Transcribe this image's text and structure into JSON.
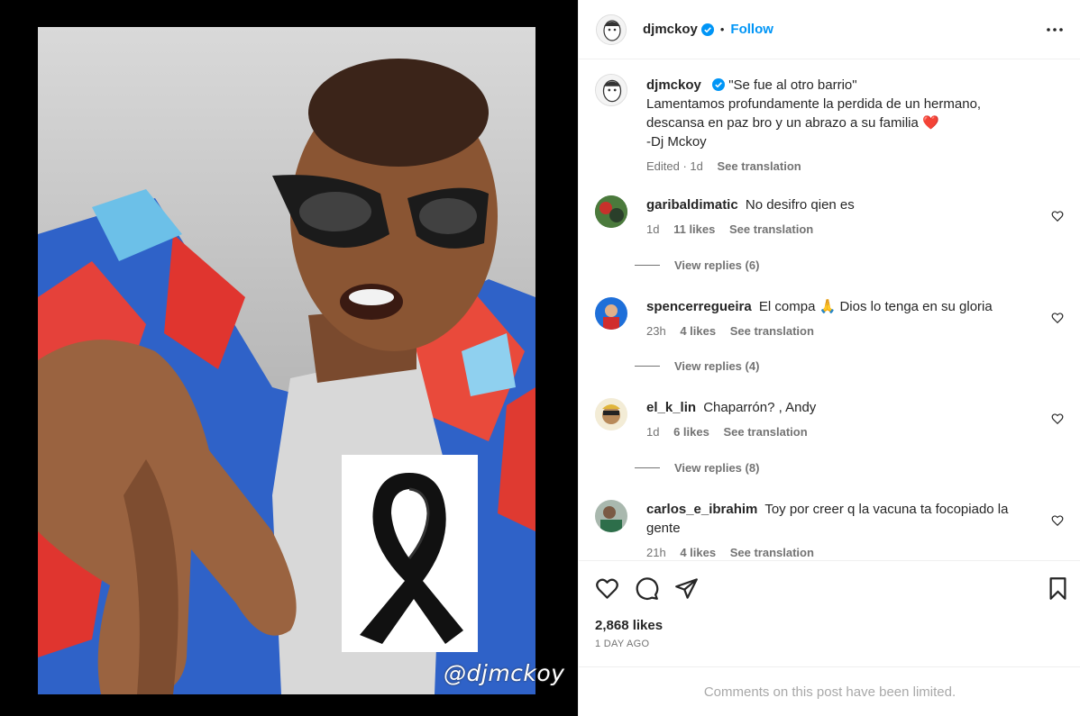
{
  "post": {
    "author": "djmckoy",
    "follow_label": "Follow",
    "watermark": "@djmckoy",
    "caption": {
      "line1": "\"Se fue al otro barrio\"",
      "line2": "Lamentamos profundamente la perdida de un hermano,",
      "line3": "descansa en paz bro y un abrazo a su familia",
      "heart": "❤️",
      "line4": "-Dj Mckoy",
      "edited": "Edited · 1d",
      "see_translation": "See translation"
    },
    "likes": "2,868 likes",
    "date": "1 DAY AGO",
    "limited_notice": "Comments on this post have been limited."
  },
  "comments": [
    {
      "user": "garibaldimatic",
      "text": "No desifro qien es",
      "time": "1d",
      "likes": "11 likes",
      "translate": "See translation",
      "replies": "View replies (6)",
      "avatar_color": "#3a6b3a"
    },
    {
      "user": "spencerregueira",
      "text": "El compa 🙏 Dios lo tenga en su gloria",
      "time": "23h",
      "likes": "4 likes",
      "translate": "See translation",
      "replies": "View replies (4)",
      "avatar_color": "#1e6fd9"
    },
    {
      "user": "el_k_lin",
      "text": "Chaparrón? , Andy",
      "time": "1d",
      "likes": "6 likes",
      "translate": "See translation",
      "replies": "View replies (8)",
      "avatar_color": "#d9c98a"
    },
    {
      "user": "carlos_e_ibrahim",
      "text": "Toy por creer q la vacuna ta focopiado la gente",
      "time": "21h",
      "likes": "4 likes",
      "translate": "See translation",
      "replies": "",
      "avatar_color": "#5a7a66"
    }
  ],
  "colors": {
    "link": "#0095f6",
    "verified": "#0095f6",
    "muted": "#737373",
    "heart": "#d0021b"
  },
  "icons": [
    "verified-badge-icon",
    "more-options-icon",
    "heart-icon",
    "comment-icon",
    "share-icon",
    "bookmark-icon",
    "broken-heart-icon",
    "black-ribbon-icon"
  ]
}
